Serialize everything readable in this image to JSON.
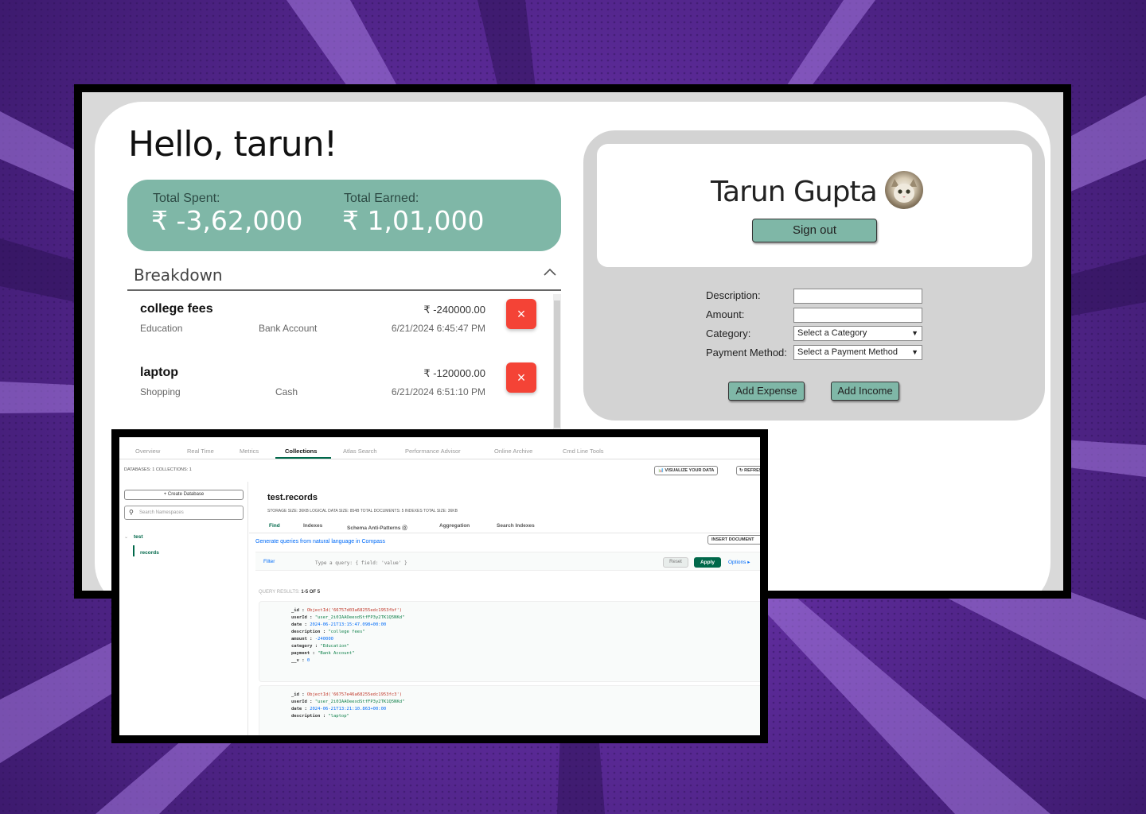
{
  "finance_app": {
    "greeting": "Hello, tarun!",
    "total_spent_label": "Total Spent:",
    "total_spent_value": "₹ -3,62,000",
    "total_earned_label": "Total Earned:",
    "total_earned_value": "₹ 1,01,000",
    "breakdown_title": "Breakdown",
    "transactions": [
      {
        "description": "college fees",
        "category": "Education",
        "payment": "Bank Account",
        "amount": "₹ -240000.00",
        "date": "6/21/2024 6:45:47 PM"
      },
      {
        "description": "laptop",
        "category": "Shopping",
        "payment": "Cash",
        "amount": "₹ -120000.00",
        "date": "6/21/2024 6:51:10 PM"
      }
    ],
    "delete_glyph": "×",
    "profile_name": "Tarun Gupta",
    "signout_label": "Sign out",
    "form": {
      "description_label": "Description:",
      "amount_label": "Amount:",
      "category_label": "Category:",
      "category_select": "Select a Category",
      "payment_label": "Payment Method:",
      "payment_select": "Select a Payment Method"
    },
    "add_expense_label": "Add Expense",
    "add_income_label": "Add Income"
  },
  "atlas": {
    "tabs": [
      "Overview",
      "Real Time",
      "Metrics",
      "Collections",
      "Atlas Search",
      "Performance Advisor",
      "Online Archive",
      "Cmd Line Tools"
    ],
    "active_tab": "Collections",
    "stats": "DATABASES: 1  COLLECTIONS: 1",
    "visualize_label": "📊 VISUALIZE YOUR DATA",
    "refresh_label": "↻ REFRESH",
    "create_db_label": "+ Create Database",
    "search_placeholder": "Search Namespaces",
    "db_name": "test",
    "collection_name": "records",
    "namespace": "test.records",
    "ns_stats": "STORAGE SIZE: 36KB     LOGICAL DATA SIZE: 854B     TOTAL DOCUMENTS: 5     INDEXES TOTAL SIZE: 36KB",
    "subtabs": [
      "Find",
      "Indexes",
      "Schema Anti-Patterns ⓪",
      "Aggregation",
      "Search Indexes"
    ],
    "generate_link": "Generate queries from natural language in Compass",
    "insert_label": "INSERT DOCUMENT",
    "filter_label": "Filter",
    "query_placeholder": "Type a query: { field: 'value' }",
    "reset_label": "Reset",
    "apply_label": "Apply",
    "options_label": "Options ▸",
    "results_label": "QUERY RESULTS:",
    "results_count": "1-5 OF 5",
    "doc1": {
      "id": "ObjectId('66757d03a68255edc1953fbf')",
      "userId": "\"user_2i0IAAOeexdStfFP3y2TK1Q5NKd\"",
      "date": "2024-06-21T13:15:47.098+00:00",
      "description": "\"college fees\"",
      "amount": "-240000",
      "category": "\"Education\"",
      "payment": "\"Bank Account\"",
      "v": "0"
    },
    "doc2": {
      "id": "ObjectId('66757e46a68255edc1953fc3')",
      "userId": "\"user_2i0IAAOeexdStfFP3y2TK1Q5NKd\"",
      "date": "2024-06-21T13:21:10.863+00:00",
      "description": "\"laptop\""
    }
  }
}
